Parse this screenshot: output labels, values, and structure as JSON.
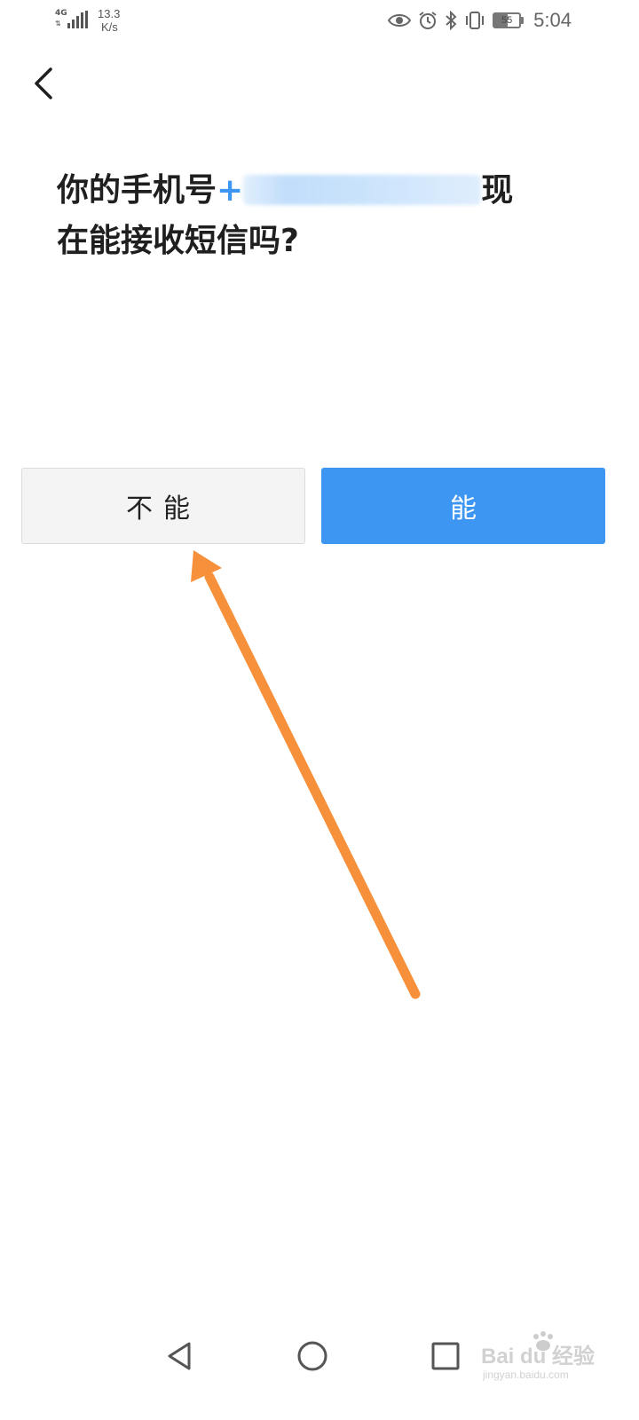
{
  "status_bar": {
    "network_type": "4G",
    "speed_value": "13.3",
    "speed_unit": "K/s",
    "battery_level": "55",
    "time": "5:04",
    "icons": [
      "eye-icon",
      "alarm-icon",
      "bluetooth-icon",
      "vibrate-icon",
      "battery-icon"
    ]
  },
  "header": {
    "back_icon": "chevron-left-icon"
  },
  "question": {
    "prefix": "你的手机号",
    "phone_visible_start": "+",
    "phone_masked": true,
    "suffix": "现",
    "line2": "在能接收短信吗?"
  },
  "buttons": {
    "no_label": "不能",
    "yes_label": "能"
  },
  "colors": {
    "accent": "#3d96f2",
    "button_secondary_bg": "#f4f4f4",
    "annotation_arrow": "#f7903a"
  },
  "nav_bar": {
    "items": [
      "back-triangle-icon",
      "home-circle-icon",
      "recent-square-icon"
    ]
  },
  "watermark": {
    "brand": "Bai du 经验",
    "url": "jingyan.baidu.com"
  }
}
